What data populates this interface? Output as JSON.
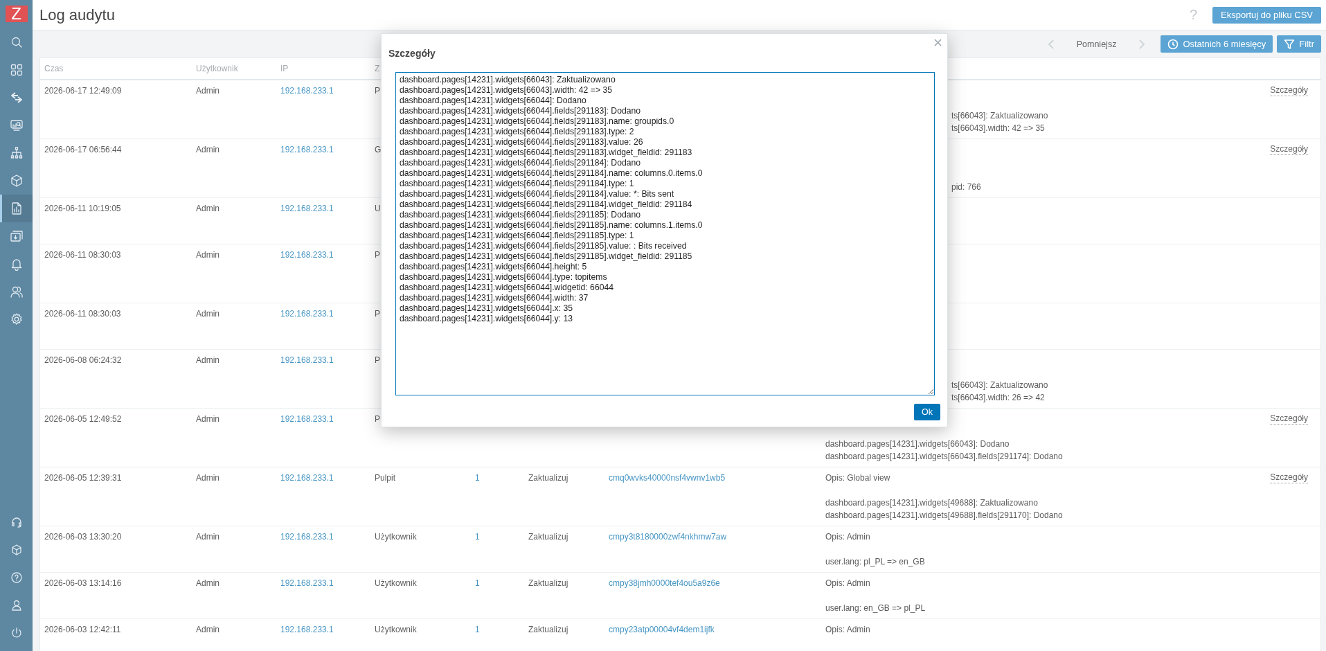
{
  "sidebar": {
    "logo": "Z",
    "items": [
      {
        "kind": "search",
        "selected": false
      },
      {
        "kind": "grid",
        "selected": false
      },
      {
        "kind": "arrows",
        "selected": false
      },
      {
        "kind": "monitor",
        "selected": false
      },
      {
        "kind": "tree",
        "selected": false
      },
      {
        "kind": "cube",
        "selected": false
      },
      {
        "kind": "report",
        "selected": true
      },
      {
        "kind": "download",
        "selected": false
      },
      {
        "kind": "bell",
        "selected": false
      },
      {
        "kind": "users",
        "selected": false
      },
      {
        "kind": "gear",
        "selected": false
      }
    ],
    "bottom_items": [
      {
        "kind": "headset",
        "selected": false
      },
      {
        "kind": "smallcube",
        "selected": false
      },
      {
        "kind": "help",
        "selected": false
      },
      {
        "kind": "user",
        "selected": false
      },
      {
        "kind": "power",
        "selected": false
      }
    ]
  },
  "header": {
    "title": "Log audytu",
    "help": "?",
    "export_button": "Eksportuj do pliku CSV"
  },
  "filter_bar": {
    "prev": {
      "disabled": true
    },
    "label": "Pomniejsz",
    "next": {
      "disabled": true
    },
    "time_button": "Ostatnich 6 miesięcy",
    "filter_button": "Filtr"
  },
  "table": {
    "columns": [
      "Czas",
      "Użytkownik",
      "IP",
      "Z"
    ],
    "rows": [
      {
        "kind": "tall",
        "covered": true,
        "time": "2026-06-17 12:49:09",
        "user": "Admin",
        "ip": "192.168.233.1",
        "resource": "P",
        "details_link": "Szczegóły",
        "details": [
          "ts[66043]: Zaktualizowano",
          "ts[66043].width: 42 => 35"
        ]
      },
      {
        "kind": "tall",
        "covered": true,
        "time": "2026-06-17 06:56:44",
        "user": "Admin",
        "ip": "192.168.233.1",
        "resource": "G",
        "details_link": "Szczegóły",
        "details": [
          "pid: 766"
        ]
      },
      {
        "kind": "short",
        "time": "2026-06-11 10:19:05",
        "user": "Admin",
        "ip": "192.168.233.1",
        "resource": "U"
      },
      {
        "kind": "tall",
        "time": "2026-06-11 08:30:03",
        "user": "Admin",
        "ip": "192.168.233.1",
        "resource": "P"
      },
      {
        "kind": "short",
        "time": "2026-06-11 08:30:03",
        "user": "Admin",
        "ip": "192.168.233.1",
        "resource": "P"
      },
      {
        "kind": "tall",
        "covered": true,
        "time": "2026-06-08 06:24:32",
        "user": "Admin",
        "ip": "192.168.233.1",
        "resource": "P",
        "details": [
          "ts[66043]: Zaktualizowano",
          "ts[66043].width: 26 => 42"
        ]
      },
      {
        "kind": "tall",
        "covered": false,
        "time": "2026-06-05 12:49:52",
        "user": "Admin",
        "ip": "192.168.233.1",
        "resource": "P",
        "details_link": "Szczegóły",
        "details": [
          "dashboard.pages[14231].widgets[66043]: Dodano",
          "dashboard.pages[14231].widgets[66043].fields[291174]: Dodano"
        ]
      },
      {
        "kind": "tall",
        "covered": false,
        "time": "2026-06-05 12:39:31",
        "user": "Admin",
        "ip": "192.168.233.1",
        "resource": "Pulpit",
        "resource_id": "1",
        "action": "Zaktualizuj",
        "record_id": "cmq0wvks40000nsf4vwnv1wb5",
        "description": "Opis: Global view",
        "details_link": "Szczegóły",
        "details": [
          "dashboard.pages[14231].widgets[49688]: Zaktualizowano",
          "dashboard.pages[14231].widgets[49688].fields[291170]: Dodano"
        ]
      },
      {
        "kind": "short",
        "covered": false,
        "time": "2026-06-03 13:30:20",
        "user": "Admin",
        "ip": "192.168.233.1",
        "resource": "Użytkownik",
        "resource_id": "1",
        "action": "Zaktualizuj",
        "record_id": "cmpy3t8180000zwf4nkhmw7aw",
        "description": "Opis: Admin",
        "details": [
          "user.lang: pl_PL => en_GB"
        ]
      },
      {
        "kind": "short",
        "covered": false,
        "time": "2026-06-03 13:14:16",
        "user": "Admin",
        "ip": "192.168.233.1",
        "resource": "Użytkownik",
        "resource_id": "1",
        "action": "Zaktualizuj",
        "record_id": "cmpy38jmh0000tef4ou5a9z6e",
        "description": "Opis: Admin",
        "details": [
          "user.lang: en_GB => pl_PL"
        ]
      },
      {
        "kind": "short",
        "time": "2026-06-03 12:42:11",
        "user": "Admin",
        "ip": "192.168.233.1",
        "resource": "Użytkownik",
        "resource_id": "1",
        "action": "Zaktualizuj",
        "record_id": "cmpy23atp00004vf4dem1ijfk",
        "description": "Opis: Admin"
      }
    ]
  },
  "dialog": {
    "title": "Szczegóły",
    "text_lines": [
      "dashboard.pages[14231].widgets[66043]: Zaktualizowano",
      "dashboard.pages[14231].widgets[66043].width: 42 => 35",
      "dashboard.pages[14231].widgets[66044]: Dodano",
      "dashboard.pages[14231].widgets[66044].fields[291183]: Dodano",
      "dashboard.pages[14231].widgets[66044].fields[291183].name: groupids.0",
      "dashboard.pages[14231].widgets[66044].fields[291183].type: 2",
      "dashboard.pages[14231].widgets[66044].fields[291183].value: 26",
      "dashboard.pages[14231].widgets[66044].fields[291183].widget_fieldid: 291183",
      "dashboard.pages[14231].widgets[66044].fields[291184]: Dodano",
      "dashboard.pages[14231].widgets[66044].fields[291184].name: columns.0.items.0",
      "dashboard.pages[14231].widgets[66044].fields[291184].type: 1",
      "dashboard.pages[14231].widgets[66044].fields[291184].value: *: Bits sent",
      "dashboard.pages[14231].widgets[66044].fields[291184].widget_fieldid: 291184",
      "dashboard.pages[14231].widgets[66044].fields[291185]: Dodano",
      "dashboard.pages[14231].widgets[66044].fields[291185].name: columns.1.items.0",
      "dashboard.pages[14231].widgets[66044].fields[291185].type: 1",
      "dashboard.pages[14231].widgets[66044].fields[291185].value: : Bits received",
      "dashboard.pages[14231].widgets[66044].fields[291185].widget_fieldid: 291185",
      "dashboard.pages[14231].widgets[66044].height: 5",
      "dashboard.pages[14231].widgets[66044].type: topitems",
      "dashboard.pages[14231].widgets[66044].widgetid: 66044",
      "dashboard.pages[14231].widgets[66044].width: 37",
      "dashboard.pages[14231].widgets[66044].x: 35",
      "dashboard.pages[14231].widgets[66044].y: 13"
    ],
    "ok_button": "Ok"
  }
}
